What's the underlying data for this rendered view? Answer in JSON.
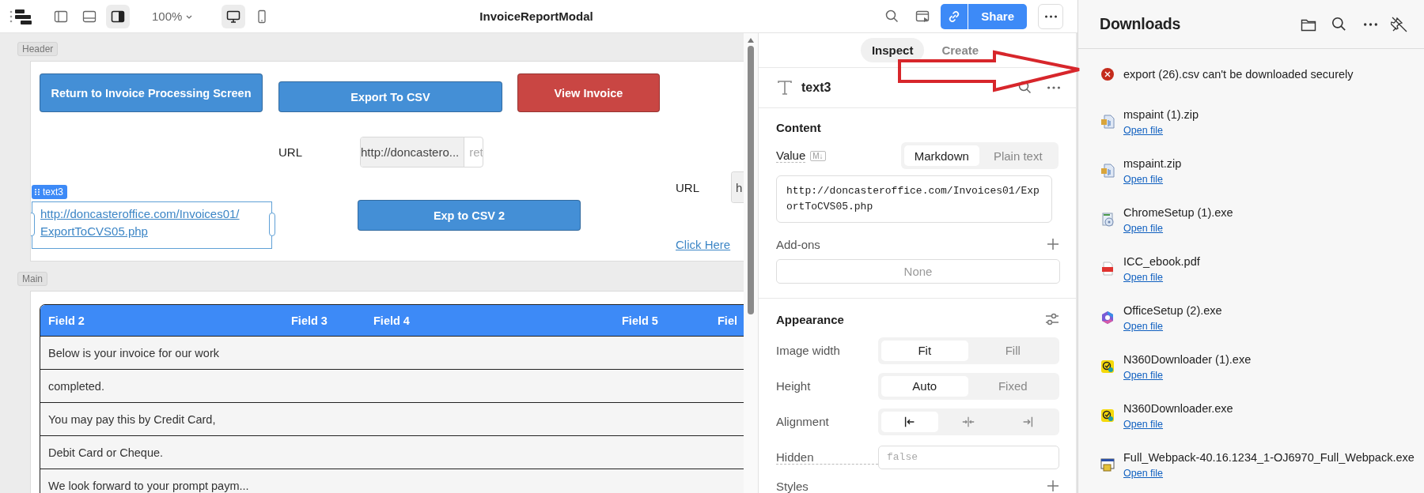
{
  "toolbar": {
    "panels": [
      {
        "kind": "left-panel",
        "selected": false
      },
      {
        "kind": "bottom-panel",
        "selected": false
      },
      {
        "kind": "right-panel",
        "selected": true
      }
    ],
    "zoom": "100%",
    "devices": [
      {
        "kind": "desktop",
        "selected": true
      },
      {
        "kind": "mobile",
        "selected": false
      }
    ],
    "title": "InvoiceReportModal",
    "share": "Share"
  },
  "canvas": {
    "header": {
      "label": "Header",
      "buttons": [
        {
          "label": "Return to Invoice Processing Screen",
          "kind": "primary"
        },
        {
          "label": "Export To CSV",
          "kind": "primary"
        },
        {
          "label": "View Invoice",
          "kind": "danger"
        }
      ],
      "url_field": {
        "label": "URL",
        "value": "http://doncastero...",
        "suffix": "ret"
      },
      "selected_text": {
        "tag": "text3",
        "link": "http://doncasteroffice.com/Invoices01/ExportToCVS05.php"
      },
      "button_2": {
        "label": "Exp to CSV 2",
        "kind": "primary"
      },
      "url_field_2": {
        "label": "URL",
        "value": "h"
      },
      "link_2": "Click Here"
    },
    "main": {
      "label": "Main",
      "table": {
        "columns": [
          "Field 2",
          "Field 3",
          "Field 4",
          "Field 5",
          "Fiel"
        ],
        "rows": [
          {
            "field_2": "Below is your invoice for our work"
          },
          {
            "field_2": "completed."
          },
          {
            "field_2": "You may pay this by Credit Card,"
          },
          {
            "field_2": "Debit Card or Cheque."
          },
          {
            "field_2": "We look forward to your prompt paym..."
          }
        ]
      }
    }
  },
  "inspect": {
    "tabs": [
      {
        "label": "Inspect",
        "selected": true
      },
      {
        "label": "Create",
        "selected": false
      }
    ],
    "component": "text3",
    "content": {
      "heading": "Content",
      "value_label": "Value",
      "badge": "M↓",
      "formats": [
        {
          "label": "Markdown",
          "selected": true
        },
        {
          "label": "Plain text",
          "selected": false
        }
      ],
      "value": "http://doncasteroffice.com/Invoices01/ExportToCVS05.php",
      "addons_label": "Add-ons",
      "addons_value": "None"
    },
    "appearance": {
      "heading": "Appearance",
      "rows": [
        {
          "label": "Image width",
          "kind": "segmented",
          "options": [
            {
              "label": "Fit",
              "selected": true
            },
            {
              "label": "Fill",
              "selected": false
            }
          ]
        },
        {
          "label": "Height",
          "kind": "segmented",
          "options": [
            {
              "label": "Auto",
              "selected": true
            },
            {
              "label": "Fixed",
              "selected": false
            }
          ]
        },
        {
          "label": "Alignment",
          "kind": "icons",
          "options": [
            {
              "kind": "left",
              "selected": true
            },
            {
              "kind": "center",
              "selected": false
            },
            {
              "kind": "right",
              "selected": false
            }
          ]
        },
        {
          "label": "Hidden",
          "kind": "input",
          "placeholder": "false"
        }
      ]
    },
    "styles_label": "Styles"
  },
  "downloads": {
    "title": "Downloads",
    "items": [
      {
        "kind": "error",
        "name": "export (26).csv can't be downloaded securely"
      },
      {
        "kind": "zip",
        "name": "mspaint (1).zip",
        "action": "Open file"
      },
      {
        "kind": "zip",
        "name": "mspaint.zip",
        "action": "Open file"
      },
      {
        "kind": "installer",
        "name": "ChromeSetup (1).exe",
        "action": "Open file"
      },
      {
        "kind": "pdf",
        "name": "ICC_ebook.pdf",
        "action": "Open file"
      },
      {
        "kind": "office",
        "name": "OfficeSetup (2).exe",
        "action": "Open file"
      },
      {
        "kind": "norton",
        "name": "N360Downloader (1).exe",
        "action": "Open file"
      },
      {
        "kind": "norton",
        "name": "N360Downloader.exe",
        "action": "Open file"
      },
      {
        "kind": "webpack",
        "name": "Full_Webpack-40.16.1234_1-OJ6970_Full_Webpack.exe",
        "action": "Open file"
      }
    ]
  }
}
